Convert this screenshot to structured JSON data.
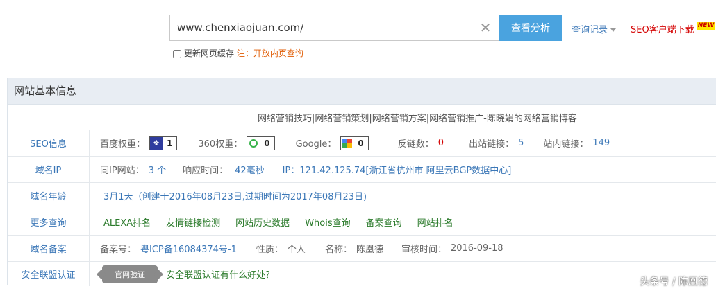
{
  "search": {
    "value": "www.chenxiaojuan.com/",
    "submit_label": "查看分析",
    "history_label": "查询记录",
    "client_label": "SEO客户端下载",
    "new_badge": "NEW",
    "cache_label": "更新网页缓存",
    "cache_note": "注：开放内页查询"
  },
  "panel": {
    "title": "网站基本信息",
    "site_title": "网络营销技巧|网络营销策划|网络营销方案|网络营销推广-陈晓娟的网络营销博客",
    "seo": {
      "label": "SEO信息",
      "baidu_label": "百度权重：",
      "baidu_value": "1",
      "so360_label": "360权重：",
      "so360_value": "0",
      "google_label": "Google：",
      "google_value": "0",
      "backlinks_label": "反链数：",
      "backlinks_value": "0",
      "outlinks_label": "出站链接：",
      "outlinks_value": "5",
      "inlinks_label": "站内链接：",
      "inlinks_value": "149"
    },
    "ip": {
      "label": "域名IP",
      "same_ip_label": "同IP网站：",
      "same_ip_value": "3 个",
      "response_label": "响应时间：",
      "response_value": "42毫秒",
      "ip_text": "IP：121.42.125.74[浙江省杭州市 阿里云BGP数据中心]"
    },
    "age": {
      "label": "域名年龄",
      "value": "3月1天（创建于2016年08月23日,过期时间为2017年08月23日)"
    },
    "more": {
      "label": "更多查询",
      "links": [
        "ALEXA排名",
        "友情链接检测",
        "网站历史数据",
        "Whois查询",
        "备案查询",
        "网站排名"
      ]
    },
    "icp": {
      "label": "域名备案",
      "no_label": "备案号：",
      "no_value": "粤ICP备16084374号-1",
      "nature_label": "性质：",
      "nature_value": "个人",
      "name_label": "名称：",
      "name_value": "陈凰德",
      "date_label": "审核时间：",
      "date_value": "2016-09-18"
    },
    "security": {
      "label": "安全联盟认证",
      "seal_text": "官网验证",
      "link": "安全联盟认证有什么好处？"
    }
  },
  "watermark": "头条号 / 陈凰德",
  "colors": {
    "accent_button": "#4aa3df",
    "link_blue": "#3b77b7",
    "highlight_red": "#d40000",
    "header_bg": "#e8edf3"
  },
  "icons": [
    "clear-icon",
    "caret-down-icon",
    "baidu-paw-icon",
    "360-icon",
    "google-icon",
    "security-seal-icon"
  ]
}
